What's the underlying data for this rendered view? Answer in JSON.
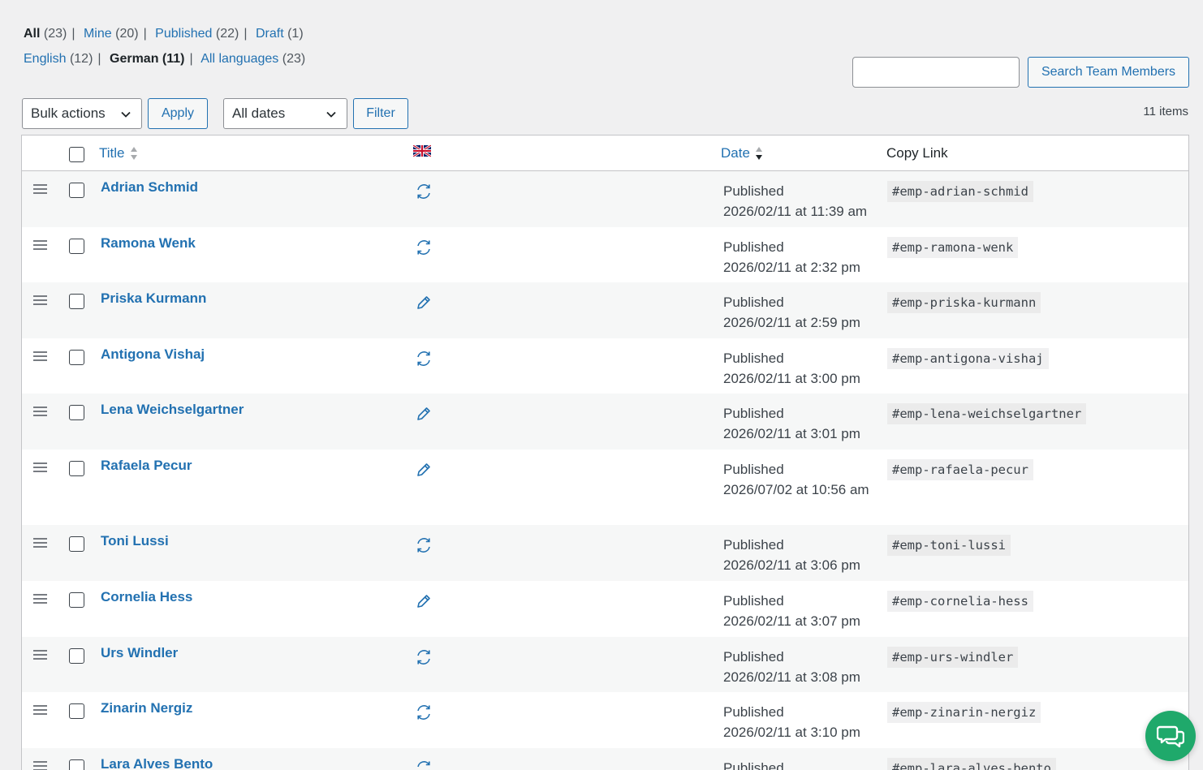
{
  "status_filters": [
    {
      "label": "All",
      "count": "(23)",
      "current": true
    },
    {
      "label": "Mine",
      "count": "(20)",
      "current": false
    },
    {
      "label": "Published",
      "count": "(22)",
      "current": false
    },
    {
      "label": "Draft",
      "count": "(1)",
      "current": false
    }
  ],
  "language_filters": [
    {
      "label": "English",
      "count": "(12)",
      "current": false
    },
    {
      "label": "German",
      "count": "(11)",
      "current": true
    },
    {
      "label": "All languages",
      "count": "(23)",
      "current": false
    }
  ],
  "search": {
    "placeholder": "",
    "button_label": "Search Team Members"
  },
  "toolbar": {
    "bulk_actions": "Bulk actions",
    "apply_label": "Apply",
    "dates_filter": "All dates",
    "filter_label": "Filter",
    "items_count": "11 items"
  },
  "columns": {
    "title": "Title",
    "date": "Date",
    "copy_link": "Copy Link"
  },
  "rows": [
    {
      "title": "Adrian Schmid",
      "status_icon": "sync-icon",
      "status": "Published",
      "date": "2026/02/11 at 11:39 am",
      "link": "#emp-adrian-schmid"
    },
    {
      "title": "Ramona Wenk",
      "status_icon": "sync-icon",
      "status": "Published",
      "date": "2026/02/11 at 2:32 pm",
      "link": "#emp-ramona-wenk"
    },
    {
      "title": "Priska Kurmann",
      "status_icon": "pencil-icon",
      "status": "Published",
      "date": "2026/02/11 at 2:59 pm",
      "link": "#emp-priska-kurmann"
    },
    {
      "title": "Antigona Vishaj",
      "status_icon": "sync-icon",
      "status": "Published",
      "date": "2026/02/11 at 3:00 pm",
      "link": "#emp-antigona-vishaj"
    },
    {
      "title": "Lena Weichselgartner",
      "status_icon": "pencil-icon",
      "status": "Published",
      "date": "2026/02/11 at 3:01 pm",
      "link": "#emp-lena-weichselgartner"
    },
    {
      "title": "Rafaela Pecur",
      "status_icon": "pencil-icon",
      "status": "Published",
      "date": "2026/07/02 at 10:56 am",
      "link": "#emp-rafaela-pecur"
    },
    {
      "title": "Toni Lussi",
      "status_icon": "sync-icon",
      "status": "Published",
      "date": "2026/02/11 at 3:06 pm",
      "link": "#emp-toni-lussi"
    },
    {
      "title": "Cornelia Hess",
      "status_icon": "pencil-icon",
      "status": "Published",
      "date": "2026/02/11 at 3:07 pm",
      "link": "#emp-cornelia-hess"
    },
    {
      "title": "Urs Windler",
      "status_icon": "sync-icon",
      "status": "Published",
      "date": "2026/02/11 at 3:08 pm",
      "link": "#emp-urs-windler"
    },
    {
      "title": "Zinarin Nergiz",
      "status_icon": "sync-icon",
      "status": "Published",
      "date": "2026/02/11 at 3:10 pm",
      "link": "#emp-zinarin-nergiz"
    },
    {
      "title": "Lara Alves Bento",
      "status_icon": "sync-icon",
      "status": "Published",
      "date": "",
      "link": "#emp-lara-alves-bento"
    }
  ],
  "colors": {
    "link": "#2271b1",
    "chat_button": "#1fa96b"
  }
}
